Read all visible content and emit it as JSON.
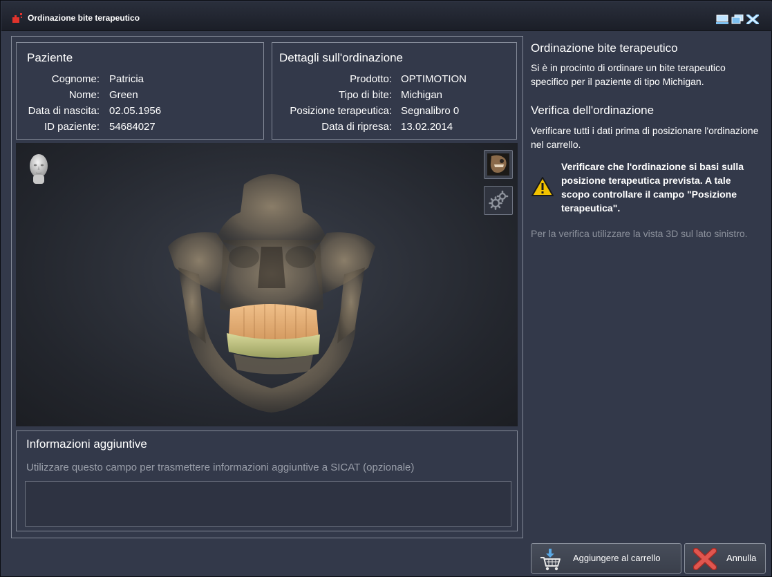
{
  "window": {
    "title": "Ordinazione bite terapeutico"
  },
  "patient": {
    "heading": "Paziente",
    "fields": [
      {
        "label": "Cognome:",
        "value": "Patricia"
      },
      {
        "label": "Nome:",
        "value": "Green"
      },
      {
        "label": "Data di nascita:",
        "value": "02.05.1956"
      },
      {
        "label": "ID paziente:",
        "value": "54684027"
      }
    ]
  },
  "order": {
    "heading": "Dettagli sull'ordinazione",
    "fields": [
      {
        "label": "Prodotto:",
        "value": "OPTIMOTION"
      },
      {
        "label": "Tipo di bite:",
        "value": "Michigan"
      },
      {
        "label": "Posizione terapeutica:",
        "value": "Segnalibro 0"
      },
      {
        "label": "Data di ripresa:",
        "value": "13.02.2014"
      }
    ]
  },
  "viewer": {
    "icons": [
      "head-orientation-icon",
      "volume-view-icon",
      "settings-gears-icon"
    ]
  },
  "additional_info": {
    "heading": "Informazioni aggiuntive",
    "hint": "Utilizzare questo campo per trasmettere informazioni aggiuntive a SICAT (opzionale)",
    "value": ""
  },
  "help": {
    "title": "Ordinazione bite terapeutico",
    "intro": "Si è in procinto di ordinare un bite terapeutico specifico per il paziente di tipo Michigan.",
    "check_title": "Verifica dell'ordinazione",
    "check_text": "Verificare tutti i dati prima di posizionare l'ordinazione nel carrello.",
    "warning": "Verificare che l'ordinazione si basi sulla posizione terapeutica prevista. A tale scopo controllare il campo \"Posizione terapeutica\".",
    "note": "Per la verifica utilizzare la vista 3D sul lato sinistro."
  },
  "actions": {
    "add_to_cart": "Aggiungere al carrello",
    "cancel": "Annulla"
  },
  "colors": {
    "background": "#33394a",
    "border": "#858b99",
    "warning": "#f2c200",
    "cancel": "#d9443e"
  }
}
